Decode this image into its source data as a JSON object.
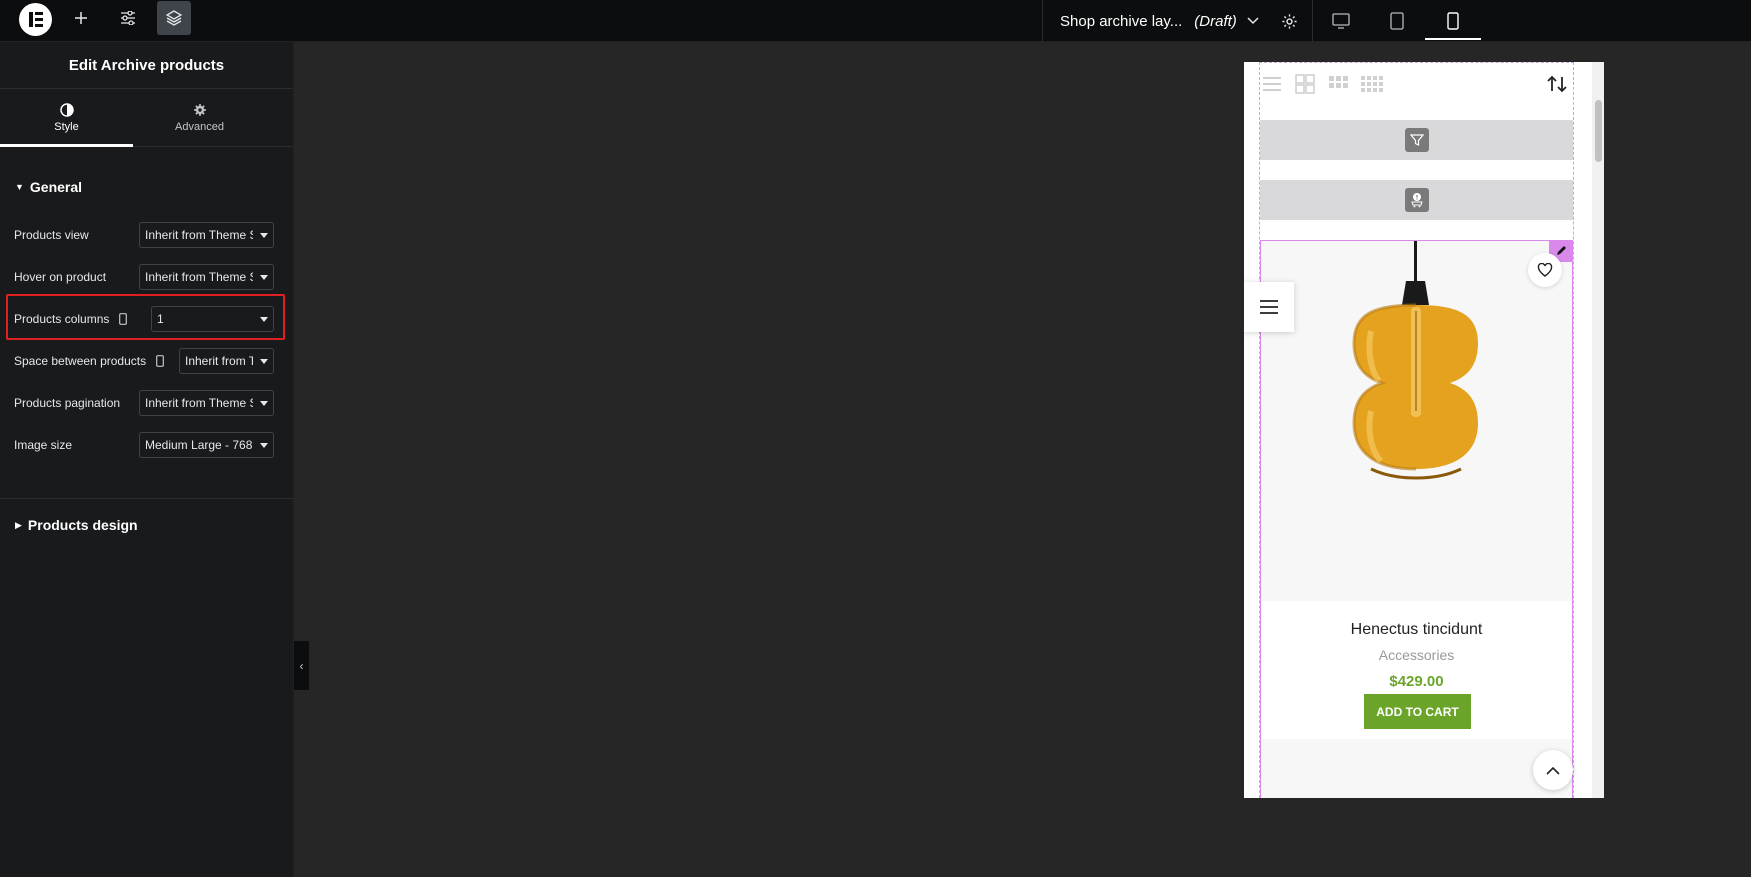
{
  "topbar": {
    "document_title": "Shop archive lay...",
    "document_status": "(Draft)"
  },
  "panel": {
    "title": "Edit Archive products",
    "tabs": [
      {
        "label": "Style",
        "icon": "adjust-icon",
        "active": true
      },
      {
        "label": "Advanced",
        "icon": "gear-icon",
        "active": false
      }
    ],
    "general": {
      "heading": "General",
      "rows": [
        {
          "label": "Products view",
          "value": "Inherit from Theme Settings",
          "responsive": false
        },
        {
          "label": "Hover on product",
          "value": "Inherit from Theme Settings",
          "responsive": false
        },
        {
          "label": "Products columns",
          "value": "1",
          "responsive": true
        },
        {
          "label": "Space between products",
          "value": "Inherit from Theme",
          "responsive": true
        },
        {
          "label": "Products pagination",
          "value": "Inherit from Theme Settings",
          "responsive": false
        },
        {
          "label": "Image size",
          "value": "Medium Large - 768",
          "responsive": false
        }
      ]
    },
    "products_design": {
      "heading": "Products design"
    }
  },
  "preview": {
    "product": {
      "name": "Henectus tincidunt",
      "category": "Accessories",
      "price": "$429.00",
      "button": "ADD TO CART"
    }
  },
  "colors": {
    "accent_green": "#6aa529",
    "highlight_red": "#e02020",
    "edit_pink": "#d889ea"
  }
}
